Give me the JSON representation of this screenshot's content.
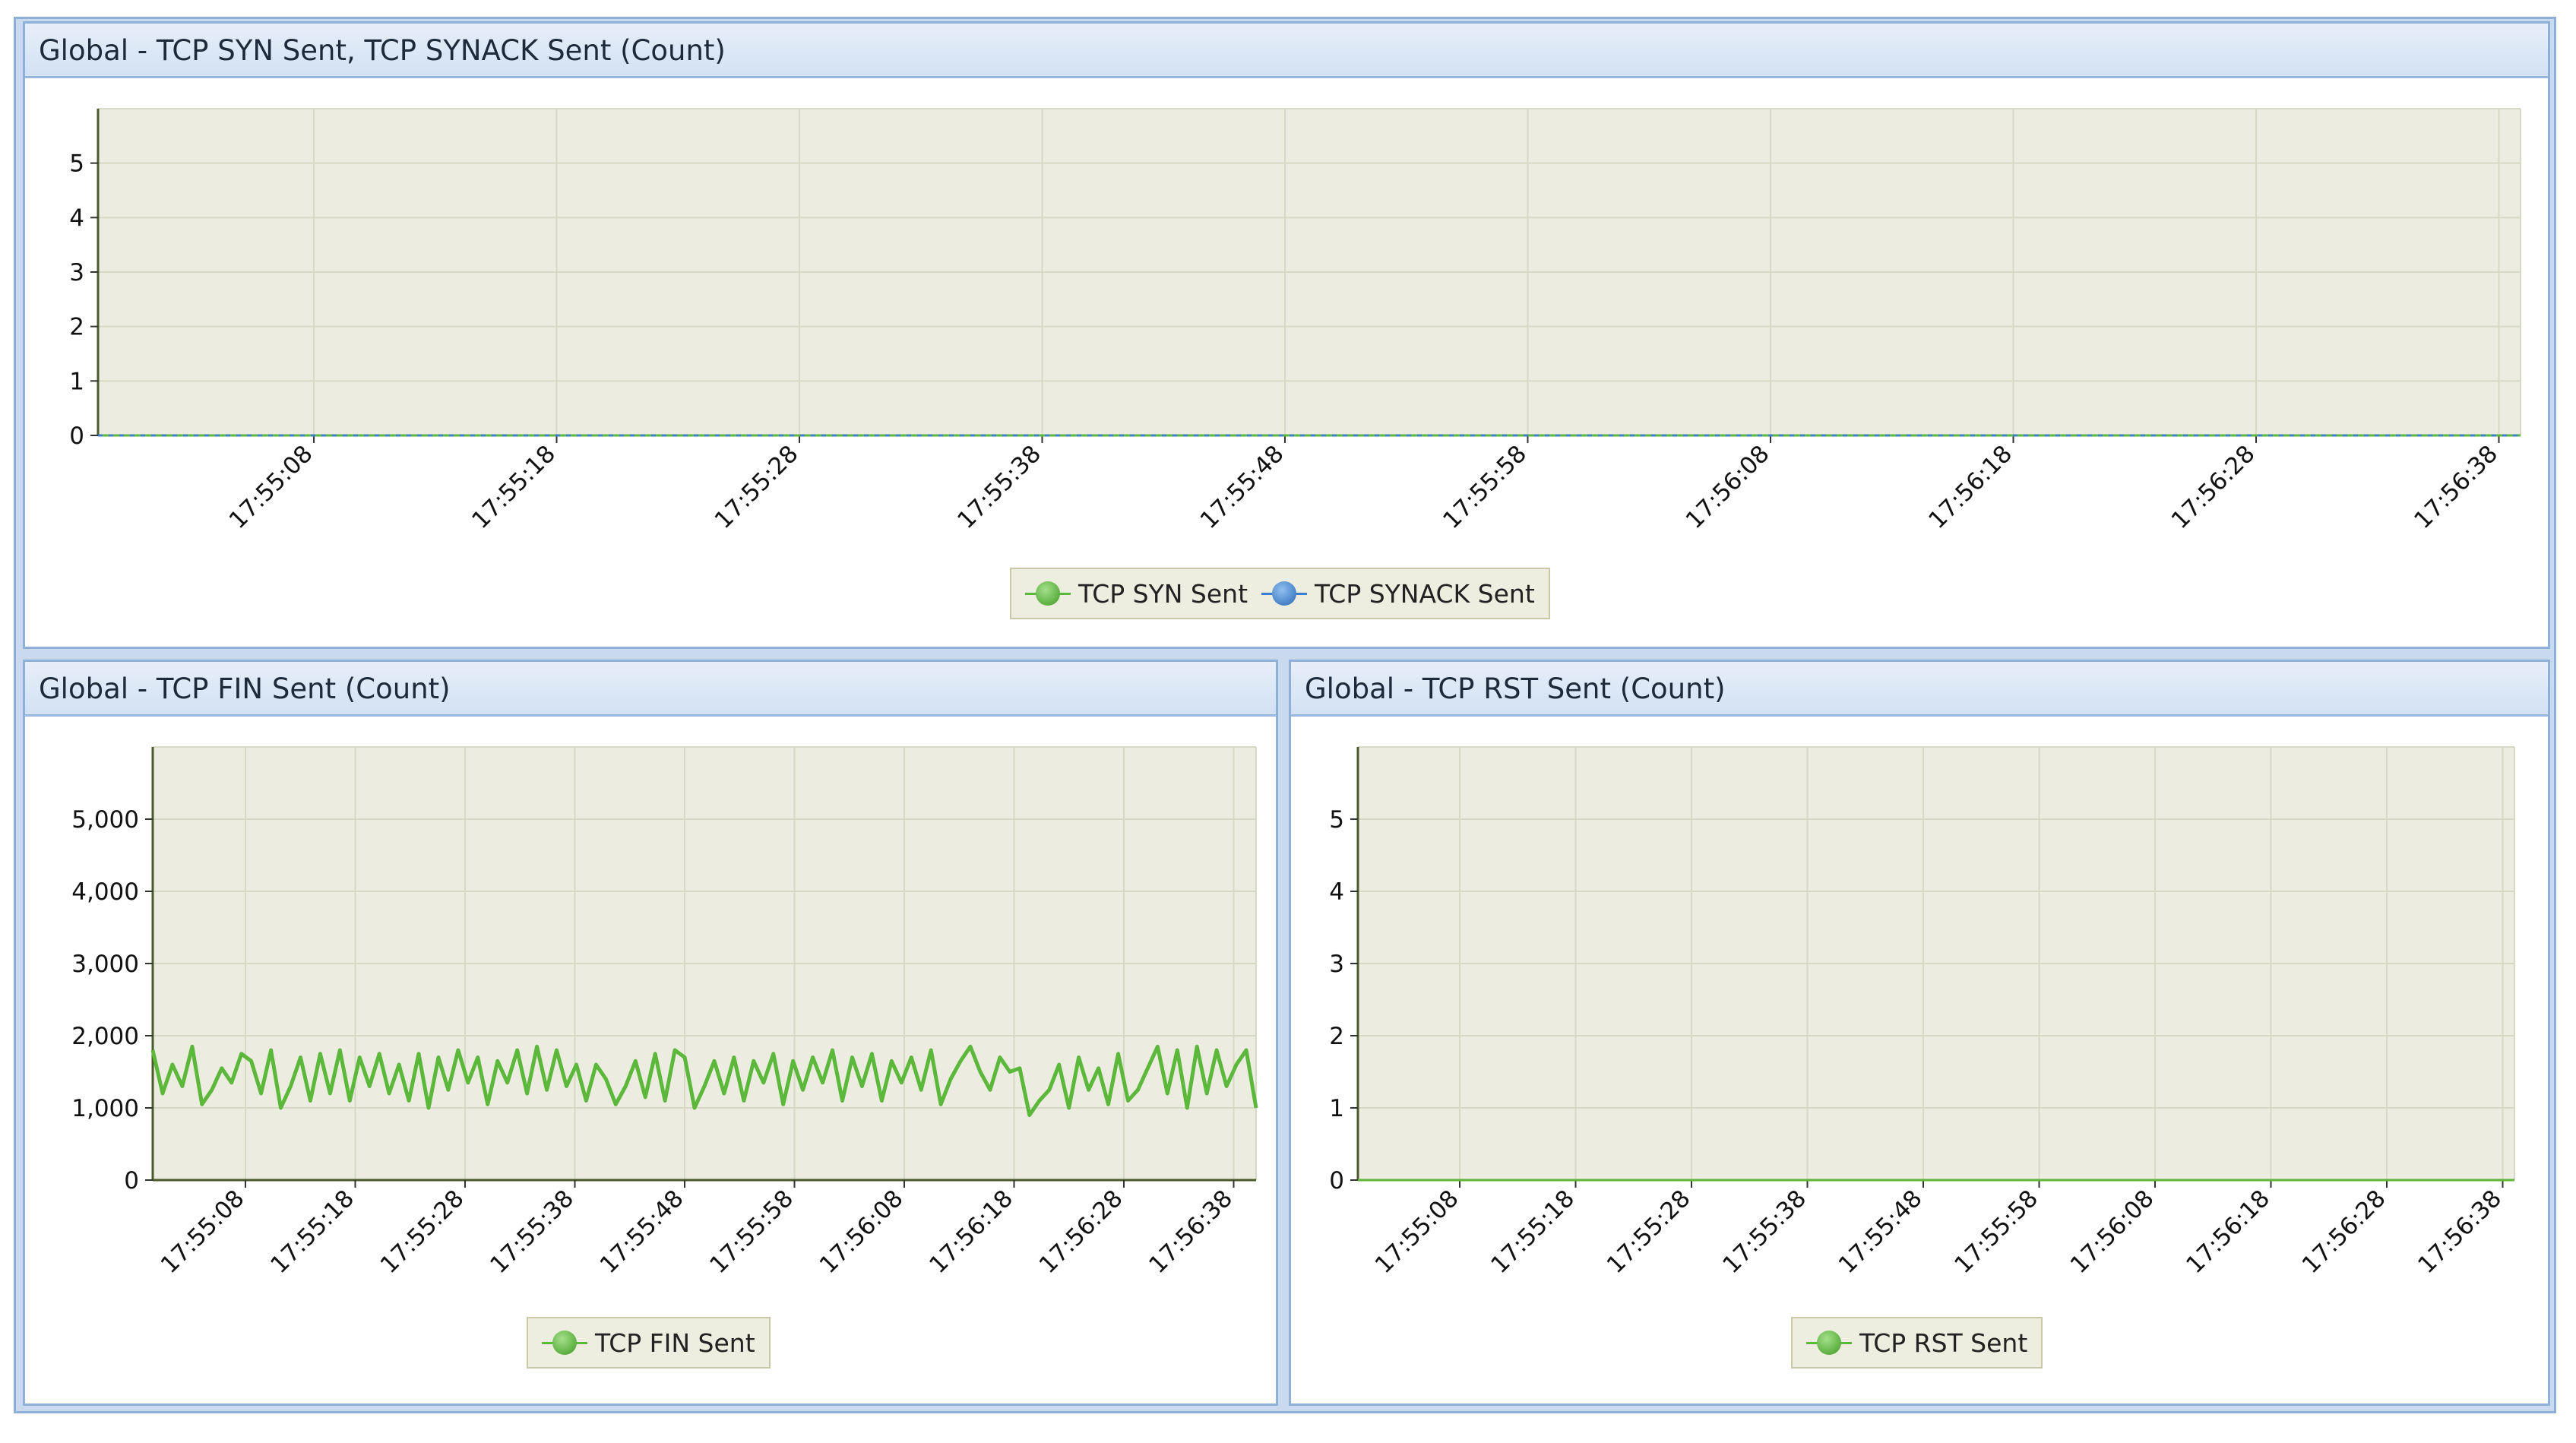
{
  "panels": {
    "top": {
      "title": "Global - TCP SYN Sent, TCP SYNACK Sent (Count)"
    },
    "bottom_left": {
      "title": "Global - TCP FIN Sent (Count)"
    },
    "bottom_right": {
      "title": "Global - TCP RST Sent (Count)"
    }
  },
  "colors": {
    "green": "#5cb83a",
    "blue": "#3c7fcf",
    "plot_bg": "#ecede0",
    "grid": "#d6d9c4"
  },
  "chart_data": [
    {
      "id": "syn",
      "type": "line",
      "title": "Global - TCP SYN Sent, TCP SYNACK Sent (Count)",
      "categories": [
        "17:55:08",
        "17:55:18",
        "17:55:28",
        "17:55:38",
        "17:55:48",
        "17:55:58",
        "17:56:08",
        "17:56:18",
        "17:56:28",
        "17:56:38"
      ],
      "ylim": [
        0,
        6
      ],
      "yticks": [
        0,
        1,
        2,
        3,
        4,
        5
      ],
      "ytick_labels": [
        "0",
        "1",
        "2",
        "3",
        "4",
        "5"
      ],
      "grid": true,
      "legend_position": "bottom-center",
      "series": [
        {
          "name": "TCP SYN Sent",
          "color": "#5cb83a",
          "x": [
            0,
            10.1
          ],
          "values": [
            0,
            0
          ]
        },
        {
          "name": "TCP SYNACK Sent",
          "color": "#3c7fcf",
          "x": [
            0,
            10.1
          ],
          "values": [
            0,
            0
          ]
        }
      ]
    },
    {
      "id": "fin",
      "type": "line",
      "title": "Global - TCP FIN Sent (Count)",
      "categories": [
        "17:55:08",
        "17:55:18",
        "17:55:28",
        "17:55:38",
        "17:55:48",
        "17:55:58",
        "17:56:08",
        "17:56:18",
        "17:56:28",
        "17:56:38"
      ],
      "ylim": [
        0,
        6000
      ],
      "yticks": [
        0,
        1000,
        2000,
        3000,
        4000,
        5000
      ],
      "ytick_labels": [
        "0",
        "1,000",
        "2,000",
        "3,000",
        "4,000",
        "5,000"
      ],
      "grid": true,
      "legend_position": "bottom-center",
      "series": [
        {
          "name": "TCP FIN Sent",
          "color": "#5cb83a",
          "values": [
            1800,
            1200,
            1600,
            1300,
            1850,
            1050,
            1250,
            1550,
            1350,
            1750,
            1650,
            1200,
            1800,
            1000,
            1300,
            1700,
            1100,
            1750,
            1200,
            1800,
            1100,
            1700,
            1300,
            1750,
            1200,
            1600,
            1100,
            1750,
            1000,
            1700,
            1250,
            1800,
            1350,
            1700,
            1050,
            1650,
            1350,
            1800,
            1200,
            1850,
            1250,
            1800,
            1300,
            1600,
            1100,
            1600,
            1400,
            1050,
            1300,
            1650,
            1150,
            1750,
            1100,
            1800,
            1700,
            1000,
            1300,
            1650,
            1200,
            1700,
            1100,
            1650,
            1350,
            1750,
            1050,
            1650,
            1250,
            1700,
            1350,
            1800,
            1100,
            1700,
            1300,
            1750,
            1100,
            1650,
            1350,
            1700,
            1250,
            1800,
            1050,
            1400,
            1650,
            1850,
            1500,
            1250,
            1700,
            1500,
            1550,
            900,
            1100,
            1250,
            1600,
            1000,
            1700,
            1250,
            1550,
            1050,
            1750,
            1100,
            1250,
            1550,
            1850,
            1200,
            1800,
            1000,
            1850,
            1200,
            1800,
            1300,
            1600,
            1800,
            1000
          ]
        }
      ]
    },
    {
      "id": "rst",
      "type": "line",
      "title": "Global - TCP RST Sent (Count)",
      "categories": [
        "17:55:08",
        "17:55:18",
        "17:55:28",
        "17:55:38",
        "17:55:48",
        "17:55:58",
        "17:56:08",
        "17:56:18",
        "17:56:28",
        "17:56:38"
      ],
      "ylim": [
        0,
        6
      ],
      "yticks": [
        0,
        1,
        2,
        3,
        4,
        5
      ],
      "ytick_labels": [
        "0",
        "1",
        "2",
        "3",
        "4",
        "5"
      ],
      "grid": true,
      "legend_position": "bottom-center",
      "series": [
        {
          "name": "TCP RST Sent",
          "color": "#5cb83a",
          "x": [
            0,
            10.1
          ],
          "values": [
            0,
            0
          ]
        }
      ]
    }
  ]
}
